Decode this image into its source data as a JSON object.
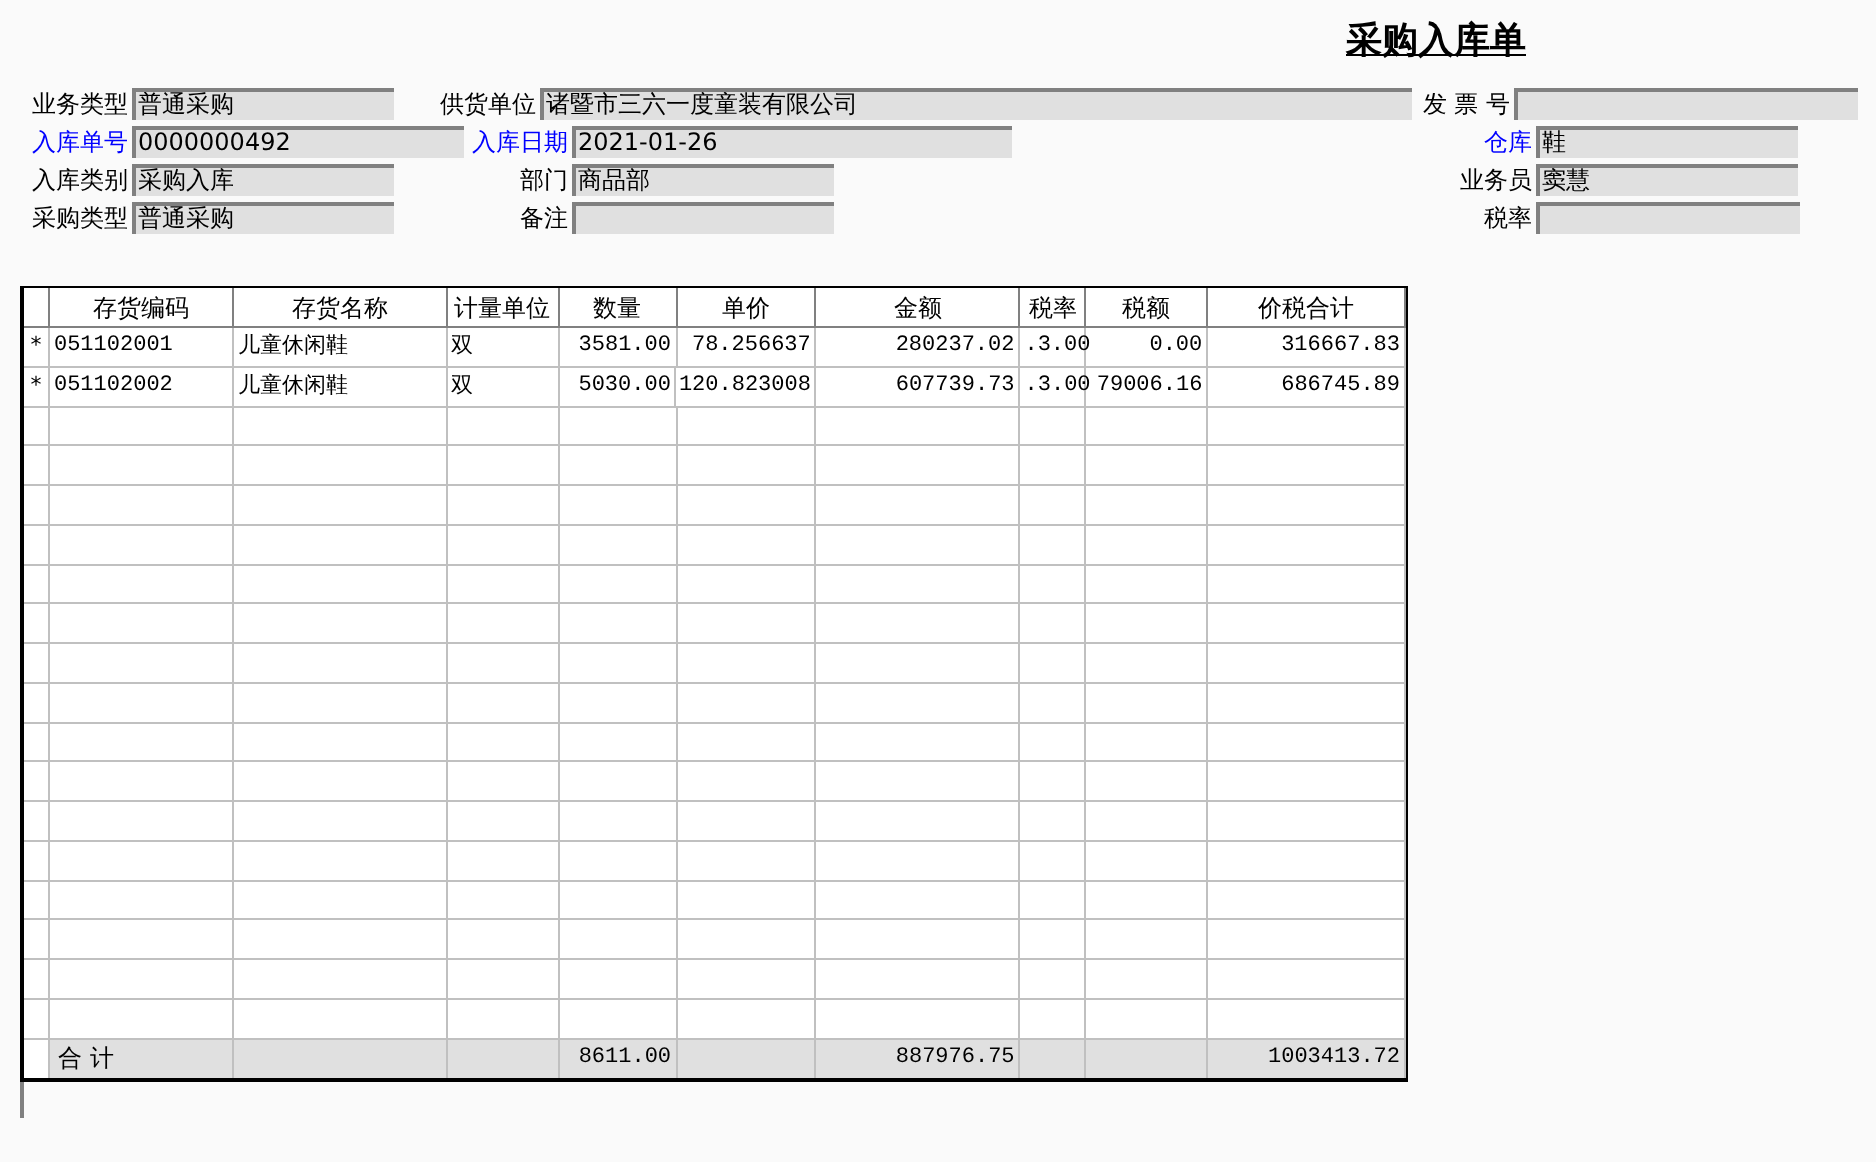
{
  "title": "采购入库单",
  "form_rows": [
    [
      {
        "label": "业务类型",
        "value": "普通采购",
        "highlighted": false
      },
      {
        "label": "供货单位",
        "value": "诸暨市三六一度童装有限公司",
        "highlighted": false
      },
      {
        "label": "发 票 号",
        "highlighted": false
      }
    ],
    [
      {
        "label": "入库单号",
        "value": "0000000492",
        "highlighted": true
      },
      {
        "label": "入库日期",
        "value": "2021-01-26",
        "highlighted": true
      },
      {
        "label": "仓库",
        "value": "鞋",
        "highlighted": true
      }
    ],
    [
      {
        "label": "入库类别",
        "value": "采购入库",
        "highlighted": false
      },
      {
        "label": "部门",
        "value": "商品部",
        "highlighted": false
      },
      {
        "label": "业务员",
        "value": "窦慧",
        "highlighted": false
      }
    ],
    [
      {
        "label": "采购类型",
        "value": "普通采购",
        "highlighted": false
      },
      {
        "label": "备注",
        "highlighted": false
      },
      {
        "label": "税率",
        "highlighted": false
      }
    ]
  ],
  "table": {
    "columns": [
      "存货编码",
      "存货名称",
      "计量单位",
      "数量",
      "单价",
      "金额",
      "税率",
      "税额",
      "价税合计"
    ],
    "rows": [
      {
        "marker": "*",
        "cells": [
          "051102001",
          "儿童休闲鞋",
          "双",
          "3581.00",
          "78.256637",
          "280237.02",
          ".3.00",
          "0.00",
          "316667.83"
        ]
      },
      {
        "marker": "*",
        "cells": [
          "051102002",
          "儿童休闲鞋",
          "双",
          "5030.00",
          "120.823008",
          "607739.73",
          ".3.00",
          "79006.16",
          "686745.89"
        ]
      }
    ],
    "total": {
      "label": "合 计",
      "cells": [
        "",
        "",
        "",
        "8611.00",
        "",
        "887976.75",
        "",
        "",
        "1003413.72"
      ]
    }
  }
}
